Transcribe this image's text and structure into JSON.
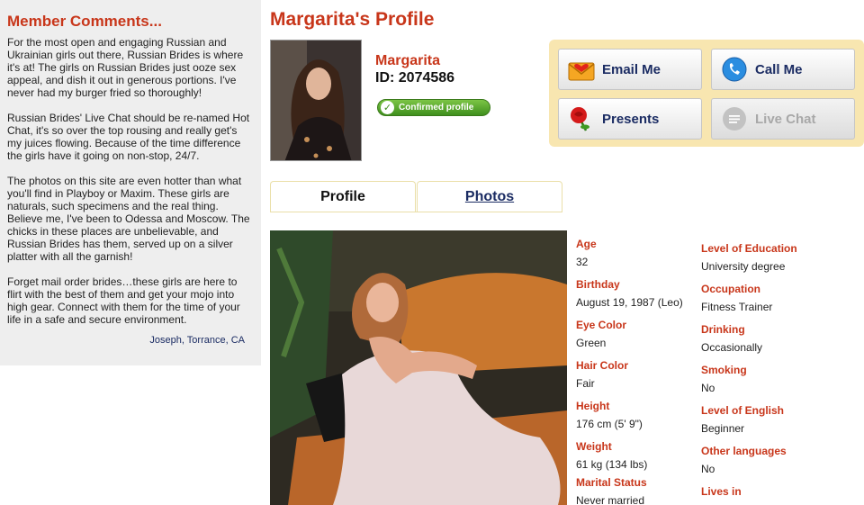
{
  "sidebar": {
    "title": "Member Comments...",
    "paragraphs": [
      "For the most open and engaging Russian and Ukrainian girls out there, Russian Brides is where it's at! The girls on Russian Brides just ooze sex appeal, and dish it out in generous portions. I've never had my burger fried so thoroughly!",
      "Russian Brides' Live Chat should be re-named Hot Chat, it's so over the top rousing and really get's my juices flowing. Because of the time difference the girls have it going on non-stop, 24/7.",
      "The photos on this site are even hotter than what you'll find in Playboy or Maxim. These girls are naturals, such specimens and the real thing. Believe me, I've been to Odessa and Moscow. The chicks in these places are unbelievable, and Russian Brides has them, served up on a silver platter with all the garnish!",
      "Forget mail order brides…these girls are here to flirt with the best of them and get your mojo into high gear. Connect with them for the time of your life in a safe and secure environment."
    ],
    "signature": "Joseph, Torrance, CA"
  },
  "profile": {
    "title": "Margarita's Profile",
    "name": "Margarita",
    "id": "ID: 2074586",
    "badge": "Confirmed profile"
  },
  "actions": {
    "email": "Email Me",
    "call": "Call Me",
    "presents": "Presents",
    "chat": "Live Chat"
  },
  "tabs": {
    "profile": "Profile",
    "photos": "Photos"
  },
  "details_left": [
    {
      "label": "Age",
      "value": "32"
    },
    {
      "label": "Birthday",
      "value": "August 19, 1987 (Leo)"
    },
    {
      "label": "Eye Color",
      "value": "Green"
    },
    {
      "label": "Hair Color",
      "value": "Fair"
    },
    {
      "label": "Height",
      "value": "176 cm (5' 9\")"
    },
    {
      "label": "Weight",
      "value": "61 kg (134 lbs)"
    },
    {
      "label": "Marital Status",
      "value": "Never married"
    }
  ],
  "details_right": [
    {
      "label": "Level of Education",
      "value": "University degree"
    },
    {
      "label": "Occupation",
      "value": "Fitness Trainer"
    },
    {
      "label": "Drinking",
      "value": "Occasionally"
    },
    {
      "label": "Smoking",
      "value": "No"
    },
    {
      "label": "Level of English",
      "value": "Beginner"
    },
    {
      "label": "Other languages",
      "value": "No"
    },
    {
      "label": "Lives in",
      "value": ""
    }
  ],
  "colors": {
    "accent": "#c8361a",
    "link": "#1b2c63",
    "panel": "#f8e6b0",
    "badge": "#3f8f1d"
  }
}
